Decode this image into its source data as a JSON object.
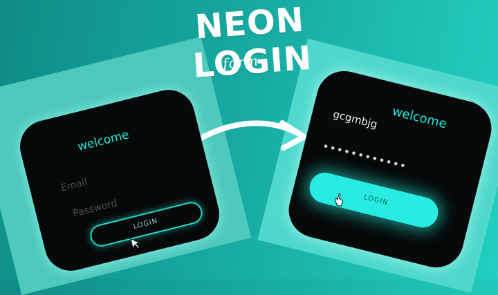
{
  "header": {
    "title": "NEON LOGIN",
    "subtitle": "form"
  },
  "left_card": {
    "welcome": "welcome",
    "email_placeholder": "Email",
    "password_placeholder": "Password",
    "login_label": "LOGIN"
  },
  "right_card": {
    "welcome": "welcome",
    "email_value": "gcgmbjg",
    "password_value": "••••••••••••",
    "login_label": "LOGIN"
  },
  "colors": {
    "accent": "#22e8d8",
    "card": "#050909",
    "background": "#16a89f"
  },
  "icons": [
    "arrow-icon",
    "pointer-cursor-icon",
    "hand-cursor-icon"
  ]
}
